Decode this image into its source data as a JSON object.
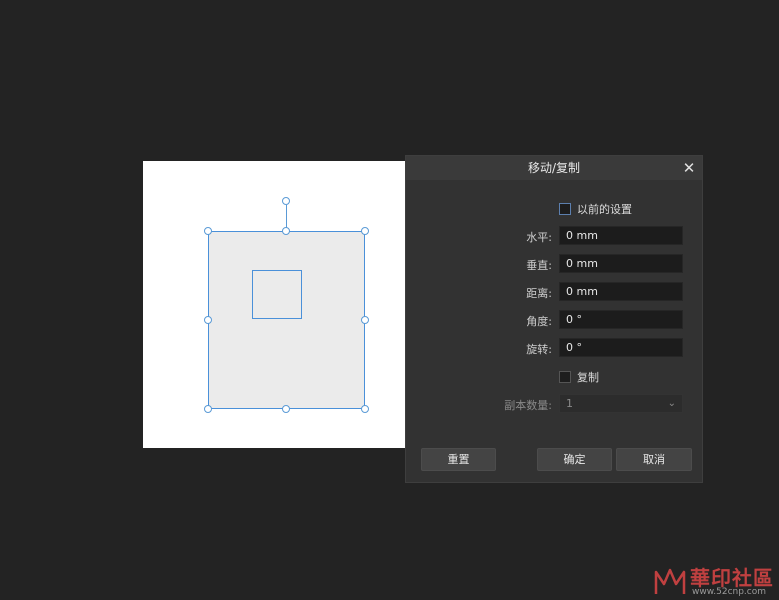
{
  "dialog": {
    "title": "移动/复制",
    "close_icon": "close-icon",
    "previous_settings_label": "以前的设置",
    "fields": [
      {
        "label": "水平:",
        "value": "0 mm"
      },
      {
        "label": "垂直:",
        "value": "0 mm"
      },
      {
        "label": "距离:",
        "value": "0 mm"
      },
      {
        "label": "角度:",
        "value": "0 °"
      },
      {
        "label": "旋转:",
        "value": "0 °"
      }
    ],
    "copy_label": "复制",
    "copies_label": "副本数量:",
    "copies_value": "1",
    "buttons": {
      "reset": "重置",
      "ok": "确定",
      "cancel": "取消"
    }
  },
  "watermark": {
    "text": "華印社區",
    "url": "www.52cnp.com"
  },
  "colors": {
    "selection": "#4a90d9",
    "background": "#232323",
    "dialog": "#323232"
  }
}
